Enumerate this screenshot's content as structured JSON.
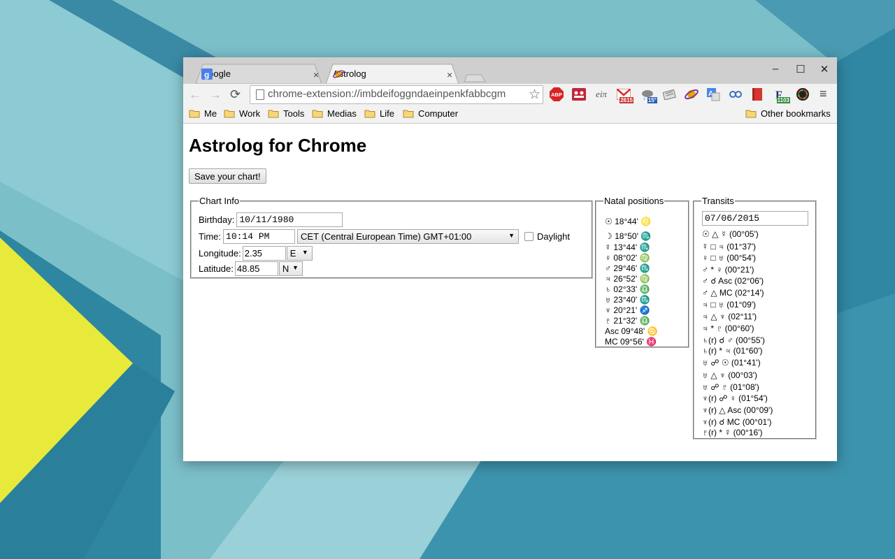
{
  "browser": {
    "tabs": [
      {
        "title": "Google",
        "favicon": "google-g-icon",
        "active": false
      },
      {
        "title": "Astrolog",
        "favicon": "saturn-icon",
        "active": true
      }
    ],
    "url": "chrome-extension://imbdeifoggndaeinpenkfabbcgm",
    "extensions": [
      {
        "name": "adblock-plus-icon",
        "label": "ABP"
      },
      {
        "name": "meetup-icon",
        "label": ""
      },
      {
        "name": "math-icon",
        "label": "eiπ"
      },
      {
        "name": "gmail-icon",
        "label": "",
        "badge": "2615"
      },
      {
        "name": "weather-icon",
        "label": "",
        "badge": "15°"
      },
      {
        "name": "news-icon",
        "label": ""
      },
      {
        "name": "saturn-ext-icon",
        "label": ""
      },
      {
        "name": "translate-icon",
        "label": ""
      },
      {
        "name": "link-icon",
        "label": ""
      },
      {
        "name": "bookmark-red-icon",
        "label": ""
      },
      {
        "name": "feedly-icon",
        "label": "",
        "badge": "1103"
      },
      {
        "name": "color-wheel-icon",
        "label": ""
      }
    ],
    "bookmarks": [
      "Me",
      "Work",
      "Tools",
      "Medias",
      "Life",
      "Computer"
    ],
    "other_bookmarks": "Other bookmarks"
  },
  "page": {
    "title": "Astrolog for Chrome",
    "save_button": "Save your chart!"
  },
  "chart_info": {
    "legend": "Chart Info",
    "birthday_label": "Birthday:",
    "birthday": "10/11/1980",
    "time_label": "Time:",
    "time": "10:14 PM",
    "timezone": "CET (Central European Time) GMT+01:00",
    "daylight_label": "Daylight",
    "daylight_checked": false,
    "longitude_label": "Longitude:",
    "longitude": "2.35",
    "longitude_dir": "E",
    "latitude_label": "Latitude:",
    "latitude": "48.85",
    "latitude_dir": "N"
  },
  "natal": {
    "legend": "Natal positions",
    "rows": [
      {
        "planet": "☉",
        "deg": "18°44'",
        "sign": "♌"
      },
      {
        "planet": "☽",
        "deg": "18°50'",
        "sign": "♏"
      },
      {
        "planet": "☿",
        "deg": "13°44'",
        "sign": "♏"
      },
      {
        "planet": "♀",
        "deg": "08°02'",
        "sign": "♍"
      },
      {
        "planet": "♂",
        "deg": "29°46'",
        "sign": "♏"
      },
      {
        "planet": "♃",
        "deg": "26°52'",
        "sign": "♍"
      },
      {
        "planet": "♄",
        "deg": "02°33'",
        "sign": "♎"
      },
      {
        "planet": "♅",
        "deg": "23°40'",
        "sign": "♏"
      },
      {
        "planet": "♆",
        "deg": "20°21'",
        "sign": "♐"
      },
      {
        "planet": "♇",
        "deg": "21°32'",
        "sign": "♎"
      },
      {
        "planet": "Asc",
        "deg": "09°48'",
        "sign": "♋"
      },
      {
        "planet": "MC",
        "deg": "09°56'",
        "sign": "♓"
      }
    ]
  },
  "transits": {
    "legend": "Transits",
    "date": "07/06/2015",
    "rows": [
      "☉ △ ☿ (00°05')",
      "☿ □ ♃ (01°37')",
      "♀ □ ♅ (00°54')",
      "♂ * ♀ (00°21')",
      "♂ ☌ Asc (02°06')",
      "♂ △ MC (02°14')",
      "♃ □ ♅ (01°09')",
      "♃ △ ♆ (02°11')",
      "♃ * ♇ (00°60')",
      "♄(r) ☌ ♂ (00°55')",
      "♄(r) * ♃ (01°60')",
      "♅ ☍ ☉ (01°41')",
      "♅ △ ♆ (00°03')",
      "♅ ☍ ♇ (01°08')",
      "♆(r) ☍ ♀ (01°54')",
      "♆(r) △ Asc (00°09')",
      "♆(r) ☌ MC (00°01')",
      "♇(r) * ☿ (00°16')"
    ]
  },
  "colors": {
    "desktop_base": "#6fb8c4",
    "desktop_dark": "#2a7f9a",
    "accent_yellow": "#e7ea3b",
    "sign_color": "#e8a500"
  }
}
